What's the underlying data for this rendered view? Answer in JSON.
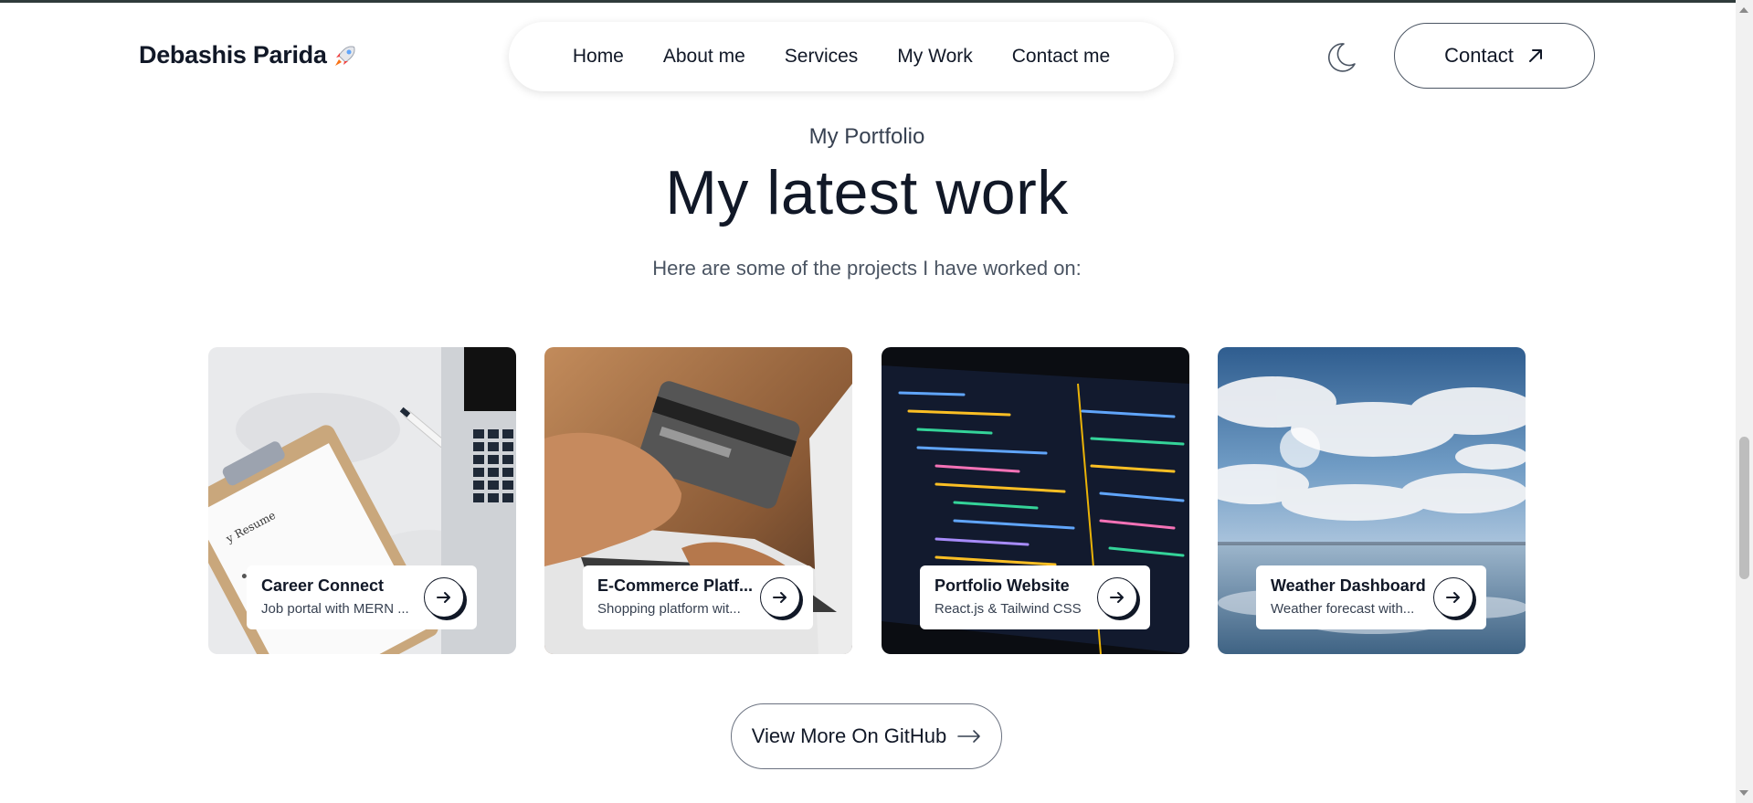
{
  "header": {
    "brand": "Debashis Parida",
    "brand_icon": "rocket-icon",
    "nav": [
      "Home",
      "About me",
      "Services",
      "My Work",
      "Contact me"
    ],
    "theme_icon": "moon-icon",
    "contact_label": "Contact",
    "contact_icon": "arrow-up-right-icon"
  },
  "section": {
    "kicker": "My Portfolio",
    "title": "My latest work",
    "subtitle": "Here are some of the projects I have worked on:"
  },
  "projects": [
    {
      "title": "Career Connect",
      "description": "Job portal with MERN ..."
    },
    {
      "title": "E-Commerce Platf...",
      "description": "Shopping platform wit..."
    },
    {
      "title": "Portfolio Website",
      "description": "React.js & Tailwind CSS"
    },
    {
      "title": "Weather Dashboard",
      "description": "Weather forecast with..."
    }
  ],
  "github_button": {
    "label": "View More On GitHub",
    "icon": "arrow-right-icon"
  },
  "colors": {
    "text_dark": "#111827",
    "text_muted": "#4b5563",
    "border": "#6b7280",
    "background": "#ffffff"
  }
}
